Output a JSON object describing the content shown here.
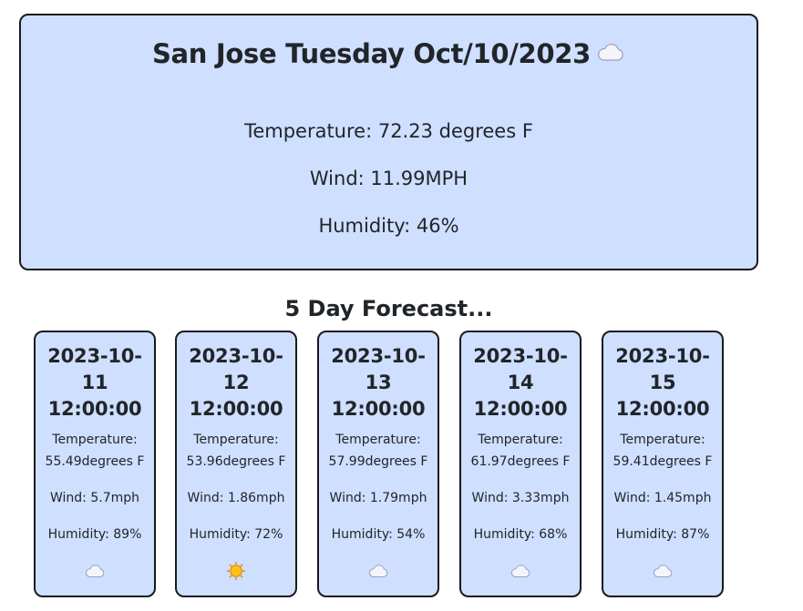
{
  "current": {
    "title": "San Jose Tuesday Oct/10/2023",
    "icon": "cloud-icon",
    "temperature": "Temperature: 72.23 degrees F",
    "wind": "Wind: 11.99MPH",
    "humidity": "Humidity: 46%"
  },
  "forecast": {
    "heading": "5 Day Forecast...",
    "days": [
      {
        "date_line1": "2023-10-",
        "date_line2": "11",
        "date_line3": "12:00:00",
        "temp_label": "Temperature:",
        "temp_value": "55.49degrees F",
        "wind": "Wind: 5.7mph",
        "humidity": "Humidity: 89%",
        "icon": "cloud-icon"
      },
      {
        "date_line1": "2023-10-",
        "date_line2": "12",
        "date_line3": "12:00:00",
        "temp_label": "Temperature:",
        "temp_value": "53.96degrees F",
        "wind": "Wind: 1.86mph",
        "humidity": "Humidity: 72%",
        "icon": "sun-icon"
      },
      {
        "date_line1": "2023-10-",
        "date_line2": "13",
        "date_line3": "12:00:00",
        "temp_label": "Temperature:",
        "temp_value": "57.99degrees F",
        "wind": "Wind: 1.79mph",
        "humidity": "Humidity: 54%",
        "icon": "cloud-icon"
      },
      {
        "date_line1": "2023-10-",
        "date_line2": "14",
        "date_line3": "12:00:00",
        "temp_label": "Temperature:",
        "temp_value": "61.97degrees F",
        "wind": "Wind: 3.33mph",
        "humidity": "Humidity: 68%",
        "icon": "cloud-icon"
      },
      {
        "date_line1": "2023-10-",
        "date_line2": "15",
        "date_line3": "12:00:00",
        "temp_label": "Temperature:",
        "temp_value": "59.41degrees F",
        "wind": "Wind: 1.45mph",
        "humidity": "Humidity: 87%",
        "icon": "cloud-icon"
      }
    ]
  },
  "colors": {
    "card_background": "#cfdfff",
    "border": "#1a1a1a",
    "sun": "#f7b500"
  }
}
